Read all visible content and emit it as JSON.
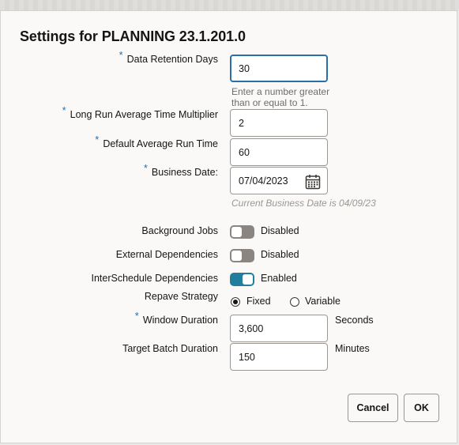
{
  "dialog": {
    "title": "Settings for PLANNING 23.1.201.0"
  },
  "fields": {
    "data_retention_days": {
      "label": "Data Retention Days",
      "value": "30",
      "hint": "Enter a number greater than or equal to 1.",
      "required": "*"
    },
    "long_run_multiplier": {
      "label": "Long Run Average Time Multiplier",
      "value": "2",
      "required": "*"
    },
    "default_avg_run_time": {
      "label": "Default Average Run Time",
      "value": "60",
      "required": "*"
    },
    "business_date": {
      "label": "Business Date:",
      "value": "07/04/2023",
      "hint": "Current Business Date is 04/09/23",
      "required": "*",
      "icon": "calendar-icon"
    }
  },
  "toggles": {
    "background_jobs": {
      "label": "Background Jobs",
      "state": "Disabled"
    },
    "external_dependencies": {
      "label": "External Dependencies",
      "state": "Disabled"
    },
    "interschedule_dependencies": {
      "label": "InterSchedule Dependencies",
      "state": "Enabled"
    }
  },
  "repave_strategy": {
    "label": "Repave Strategy",
    "options": [
      "Fixed",
      "Variable"
    ],
    "selected": "Fixed"
  },
  "window_duration": {
    "label": "Window Duration",
    "value": "3,600",
    "unit": "Seconds",
    "required": "*"
  },
  "target_batch_duration": {
    "label": "Target Batch Duration",
    "value": "150",
    "unit": "Minutes"
  },
  "buttons": {
    "cancel": "Cancel",
    "ok": "OK"
  },
  "colors": {
    "accent": "#2b6fa8",
    "toggle_on": "#227e9e",
    "toggle_off": "#8a8580"
  }
}
